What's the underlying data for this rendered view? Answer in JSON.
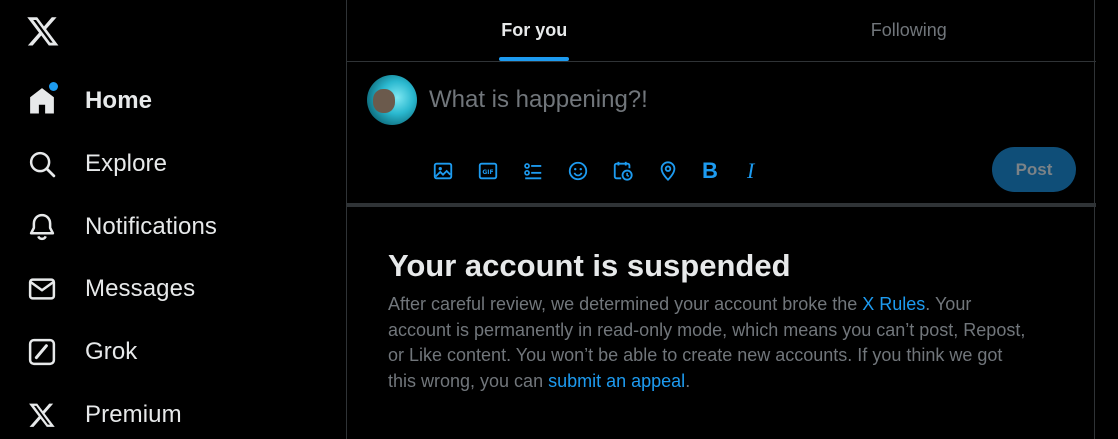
{
  "sidebar": {
    "logo": "x-logo-icon",
    "items": [
      {
        "label": "Home",
        "icon": "home-icon",
        "active": true,
        "has_dot": true
      },
      {
        "label": "Explore",
        "icon": "search-icon"
      },
      {
        "label": "Notifications",
        "icon": "bell-icon"
      },
      {
        "label": "Messages",
        "icon": "envelope-icon"
      },
      {
        "label": "Grok",
        "icon": "grok-icon"
      },
      {
        "label": "Premium",
        "icon": "x-logo-icon"
      }
    ]
  },
  "tabs": [
    {
      "label": "For you",
      "active": true
    },
    {
      "label": "Following",
      "active": false
    }
  ],
  "composer": {
    "placeholder": "What is happening?!",
    "tools": [
      "image-icon",
      "gif-icon",
      "poll-icon",
      "emoji-icon",
      "schedule-icon",
      "location-icon",
      "bold-icon",
      "italic-icon"
    ],
    "bold_label": "B",
    "italic_label": "I",
    "post_label": "Post"
  },
  "notice": {
    "title": "Your account is suspended",
    "body_part1": "After careful review, we determined your account broke the ",
    "rules_link": "X Rules",
    "body_part2": ". Your account is permanently in read-only mode, which means you can’t post, Repost, or Like content. You won’t be able to create new accounts. If you think we got this wrong, you can ",
    "appeal_link": "submit an appeal",
    "body_part3": "."
  },
  "colors": {
    "accent": "#1d9bf0",
    "background": "#000000",
    "text": "#e7e9ea",
    "muted": "#71767b",
    "border": "#2f3336",
    "post_button_disabled": "#0f4e78"
  }
}
